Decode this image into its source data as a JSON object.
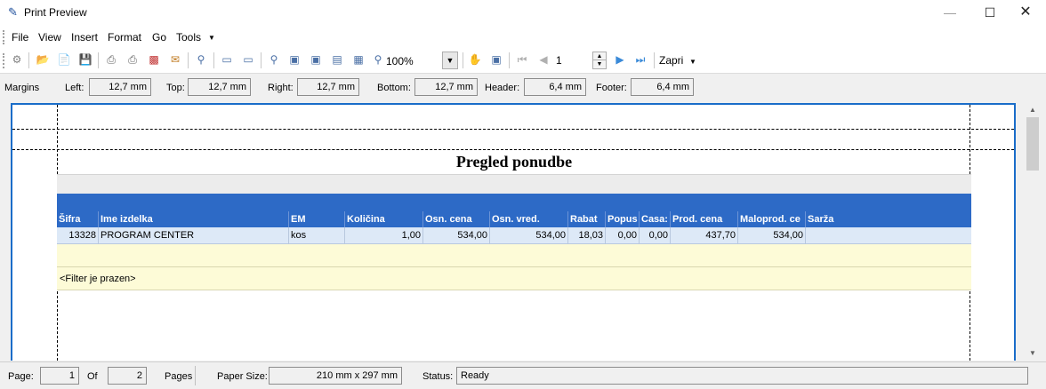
{
  "window": {
    "title": "Print Preview"
  },
  "menu": [
    "File",
    "View",
    "Insert",
    "Format",
    "Go",
    "Tools"
  ],
  "toolbar": {
    "zoom": "100%",
    "page": "1",
    "close_label": "Zapri"
  },
  "margins": {
    "label": "Margins",
    "left_label": "Left:",
    "left": "12,7 mm",
    "top_label": "Top:",
    "top": "12,7 mm",
    "right_label": "Right:",
    "right": "12,7 mm",
    "bottom_label": "Bottom:",
    "bottom": "12,7 mm",
    "header_label": "Header:",
    "header": "6,4 mm",
    "footer_label": "Footer:",
    "footer": "6,4 mm"
  },
  "report": {
    "title": "Pregled ponudbe",
    "columns": [
      "Šifra",
      "Ime izdelka",
      "EM",
      "Količina",
      "Osn. cena",
      "Osn. vred.",
      "Rabat",
      "Popus",
      "Casa:",
      "Prod. cena",
      "Maloprod. ce",
      "Sarža"
    ],
    "row": [
      "13328",
      "PROGRAM CENTER",
      "kos",
      "1,00",
      "534,00",
      "534,00",
      "18,03",
      "0,00",
      "0,00",
      "437,70",
      "534,00",
      ""
    ],
    "filter": "<Filter je prazen>"
  },
  "status": {
    "page_label": "Page:",
    "page": "1",
    "of_label": "Of",
    "of": "2",
    "pages_label": "Pages",
    "paper_label": "Paper Size:",
    "paper": "210 mm x 297 mm",
    "status_label": "Status:",
    "status": "Ready"
  }
}
